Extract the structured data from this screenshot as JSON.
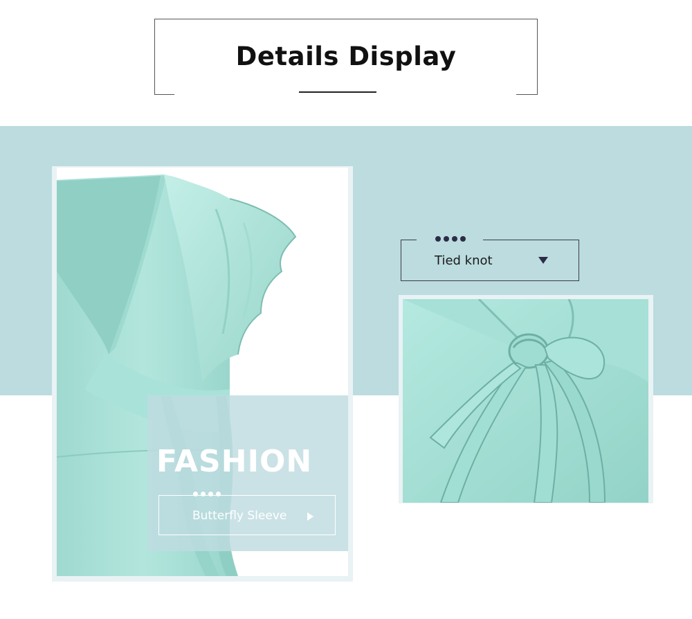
{
  "header": {
    "title": "Details Display"
  },
  "left_panel": {
    "overlay_heading": "FASHION",
    "feature_label": "Butterfly Sleeve",
    "feature_icon": "play-arrow-icon"
  },
  "right_panel": {
    "feature_label": "Tied knot",
    "feature_icon": "caret-down-icon"
  },
  "colors": {
    "band": "#bcdcdf",
    "dress": "#a6e0d8",
    "dot_dark": "#2d2c47",
    "text_dark": "#111111"
  }
}
